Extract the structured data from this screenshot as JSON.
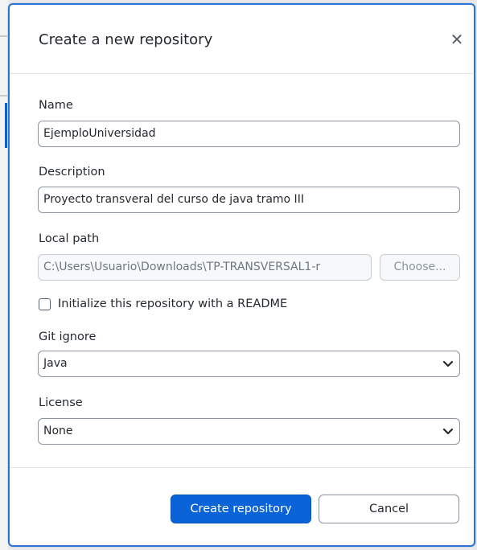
{
  "dialog": {
    "title": "Create a new repository",
    "close_icon": "close-icon"
  },
  "fields": {
    "name": {
      "label": "Name",
      "value": "EjemploUniversidad"
    },
    "description": {
      "label": "Description",
      "value": "Proyecto transveral del curso de java tramo III"
    },
    "local_path": {
      "label": "Local path",
      "value": "C:\\Users\\Usuario\\Downloads\\TP-TRANSVERSAL1-r",
      "choose_label": "Choose..."
    },
    "readme": {
      "label": "Initialize this repository with a README",
      "checked": false
    },
    "git_ignore": {
      "label": "Git ignore",
      "selected": "Java"
    },
    "license": {
      "label": "License",
      "selected": "None"
    }
  },
  "buttons": {
    "create": "Create repository",
    "cancel": "Cancel"
  },
  "colors": {
    "accent": "#0b63d8",
    "dialog_border": "#2b74d6"
  }
}
